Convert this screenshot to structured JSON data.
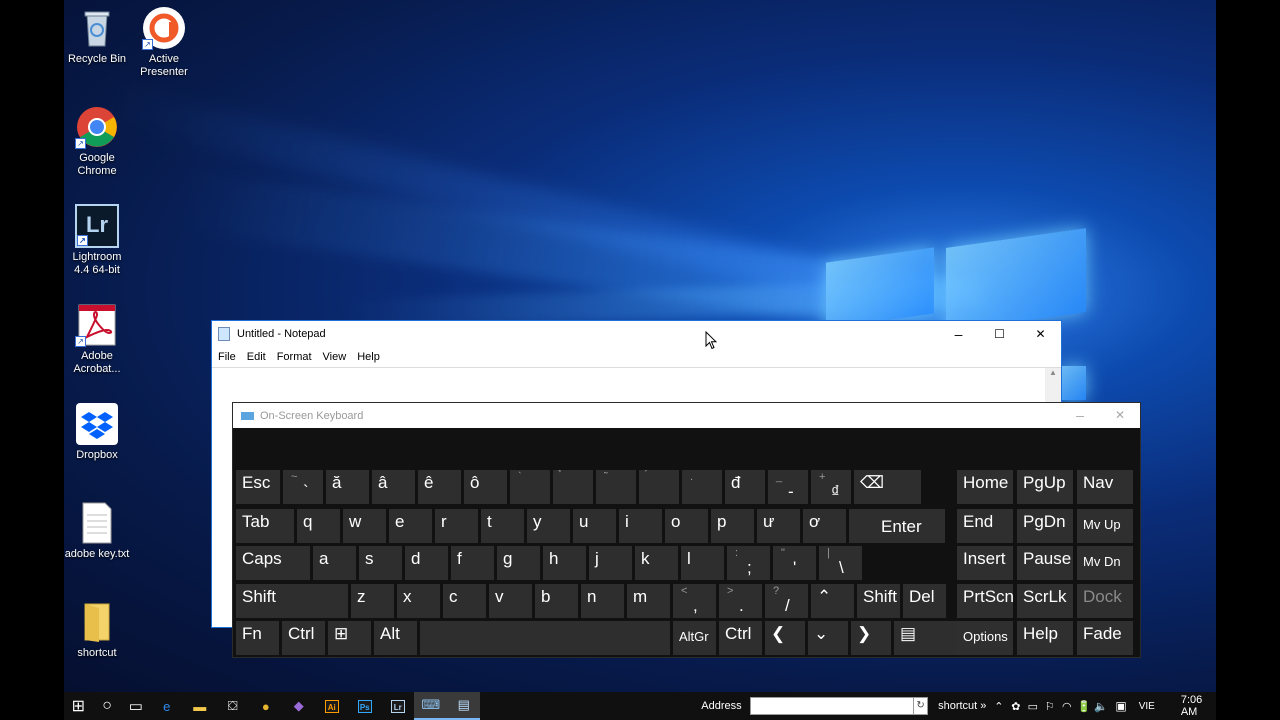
{
  "desktop": {
    "icons": [
      {
        "label": "Recycle Bin",
        "icon": "recycle-bin-icon"
      },
      {
        "label": "Active\nPresenter",
        "icon": "active-presenter-icon"
      },
      {
        "label": "Google\nChrome",
        "icon": "chrome-icon"
      },
      {
        "label": "Lightroom\n4.4 64-bit",
        "icon": "lightroom-icon"
      },
      {
        "label": "Adobe\nAcrobat...",
        "icon": "acrobat-icon"
      },
      {
        "label": "Dropbox",
        "icon": "dropbox-icon"
      },
      {
        "label": "adobe key.txt",
        "icon": "text-file-icon"
      },
      {
        "label": "shortcut",
        "icon": "folder-icon"
      }
    ],
    "lightroom_glyph": "Lr"
  },
  "notepad": {
    "title": "Untitled - Notepad",
    "menu": [
      "File",
      "Edit",
      "Format",
      "View",
      "Help"
    ],
    "minimize": "–",
    "maximize": "☐",
    "close": "✕"
  },
  "osk": {
    "title": "On-Screen Keyboard",
    "minimize": "–",
    "close": "✕",
    "row1": [
      {
        "t": "Esc"
      },
      {
        "s": "~",
        "m": "`"
      },
      {
        "t": "ă"
      },
      {
        "t": "â"
      },
      {
        "t": "ê"
      },
      {
        "t": "ô"
      },
      {
        "s": "`"
      },
      {
        "s": "̉"
      },
      {
        "s": "̃"
      },
      {
        "s": "́"
      },
      {
        "s": "."
      },
      {
        "t": "đ"
      },
      {
        "s": "_",
        "m": "-"
      },
      {
        "s": "+",
        "m": "₫"
      },
      {
        "t": "⌫"
      }
    ],
    "row2": [
      {
        "t": "Tab"
      },
      {
        "t": "q"
      },
      {
        "t": "w"
      },
      {
        "t": "e"
      },
      {
        "t": "r"
      },
      {
        "t": "t"
      },
      {
        "t": "y"
      },
      {
        "t": "u"
      },
      {
        "t": "i"
      },
      {
        "t": "o"
      },
      {
        "t": "p"
      },
      {
        "t": "ư"
      },
      {
        "t": "ơ"
      },
      {
        "t": "Enter"
      }
    ],
    "row3": [
      {
        "t": "Caps"
      },
      {
        "t": "a"
      },
      {
        "t": "s"
      },
      {
        "t": "d"
      },
      {
        "t": "f"
      },
      {
        "t": "g"
      },
      {
        "t": "h"
      },
      {
        "t": "j"
      },
      {
        "t": "k"
      },
      {
        "t": "l"
      },
      {
        "s": ":",
        "m": ";"
      },
      {
        "s": "\"",
        "m": "'"
      },
      {
        "s": "|",
        "m": "\\"
      }
    ],
    "row4": [
      {
        "t": "Shift"
      },
      {
        "t": "z"
      },
      {
        "t": "x"
      },
      {
        "t": "c"
      },
      {
        "t": "v"
      },
      {
        "t": "b"
      },
      {
        "t": "n"
      },
      {
        "t": "m"
      },
      {
        "s": "<",
        "m": ","
      },
      {
        "s": ">",
        "m": "."
      },
      {
        "s": "?",
        "m": "/"
      },
      {
        "t": "⌃"
      },
      {
        "t": "Shift"
      },
      {
        "t": "Del"
      }
    ],
    "row5": [
      {
        "t": "Fn"
      },
      {
        "t": "Ctrl"
      },
      {
        "t": "⊞"
      },
      {
        "t": "Alt"
      },
      {
        "t": ""
      },
      {
        "t": "AltGr"
      },
      {
        "t": "Ctrl"
      },
      {
        "t": "❮"
      },
      {
        "t": "⌄"
      },
      {
        "t": "❯"
      },
      {
        "t": "▤"
      }
    ],
    "nav": [
      [
        "Home",
        "PgUp",
        "Nav"
      ],
      [
        "End",
        "PgDn",
        "Mv Up"
      ],
      [
        "Insert",
        "Pause",
        "Mv Dn"
      ],
      [
        "PrtScn",
        "ScrLk",
        "Dock"
      ],
      [
        "Options",
        "Help",
        "Fade"
      ]
    ]
  },
  "taskbar": {
    "start": "⊞",
    "search": "○",
    "taskview": "▭",
    "apps": [
      {
        "icon": "edge-icon",
        "glyph": "e",
        "color": "#2d8cf0"
      },
      {
        "icon": "file-explorer-icon",
        "glyph": "▬",
        "color": "#f2c94c"
      },
      {
        "icon": "store-icon",
        "glyph": "⛋",
        "color": "#ffffff"
      },
      {
        "icon": "chrome-icon",
        "glyph": "●",
        "color": "#e6b530"
      },
      {
        "icon": "visual-studio-icon",
        "glyph": "◆",
        "color": "#9a6ad8"
      },
      {
        "icon": "illustrator-icon",
        "glyph": "Ai",
        "color": "#ff9a00"
      },
      {
        "icon": "photoshop-icon",
        "glyph": "Ps",
        "color": "#31a8ff"
      },
      {
        "icon": "lightroom-icon",
        "glyph": "Lr",
        "color": "#b5d4f0"
      },
      {
        "icon": "on-screen-keyboard-icon",
        "glyph": "⌨",
        "color": "#8ec3f2"
      },
      {
        "icon": "notepad-icon",
        "glyph": "▤",
        "color": "#bfe0ff"
      }
    ],
    "address_label": "Address",
    "address_value": "",
    "address_go": "↻",
    "toolbar_label": "shortcut",
    "toolbar_more": "»",
    "tray_icons": [
      "⌃",
      "✿",
      "▭",
      "⚐",
      "◠",
      "🔋",
      "🔈"
    ],
    "notifications": "▣",
    "language": "VIE",
    "time": "7:06 AM"
  }
}
